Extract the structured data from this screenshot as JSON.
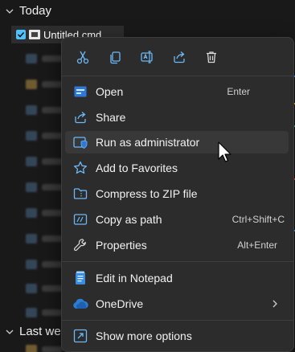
{
  "explorer": {
    "group_today": "Today",
    "group_last_week": "Last wee",
    "selected_file_name": "Untitled.cmd"
  },
  "context_menu": {
    "toolbar": [
      {
        "name": "cut-icon",
        "label": "Cut"
      },
      {
        "name": "copy-icon",
        "label": "Copy"
      },
      {
        "name": "rename-icon",
        "label": "Rename"
      },
      {
        "name": "share-toolbar-icon",
        "label": "Share"
      },
      {
        "name": "delete-icon",
        "label": "Delete"
      }
    ],
    "items": {
      "open": {
        "label": "Open",
        "shortcut": "Enter"
      },
      "share": {
        "label": "Share"
      },
      "run_as_admin": {
        "label": "Run as administrator"
      },
      "add_to_favorites": {
        "label": "Add to Favorites"
      },
      "compress_zip": {
        "label": "Compress to ZIP file"
      },
      "copy_as_path": {
        "label": "Copy as path",
        "shortcut": "Ctrl+Shift+C"
      },
      "properties": {
        "label": "Properties",
        "shortcut": "Alt+Enter"
      },
      "edit_in_notepad": {
        "label": "Edit in Notepad"
      },
      "onedrive": {
        "label": "OneDrive"
      },
      "show_more_options": {
        "label": "Show more options"
      }
    }
  },
  "colors": {
    "accent": "#4cc2ff",
    "menu_background": "#2c2c2c",
    "hover_background": "#383838",
    "notepad_blue": "#3a8dde",
    "onedrive_blue": "#2b7cd3"
  }
}
